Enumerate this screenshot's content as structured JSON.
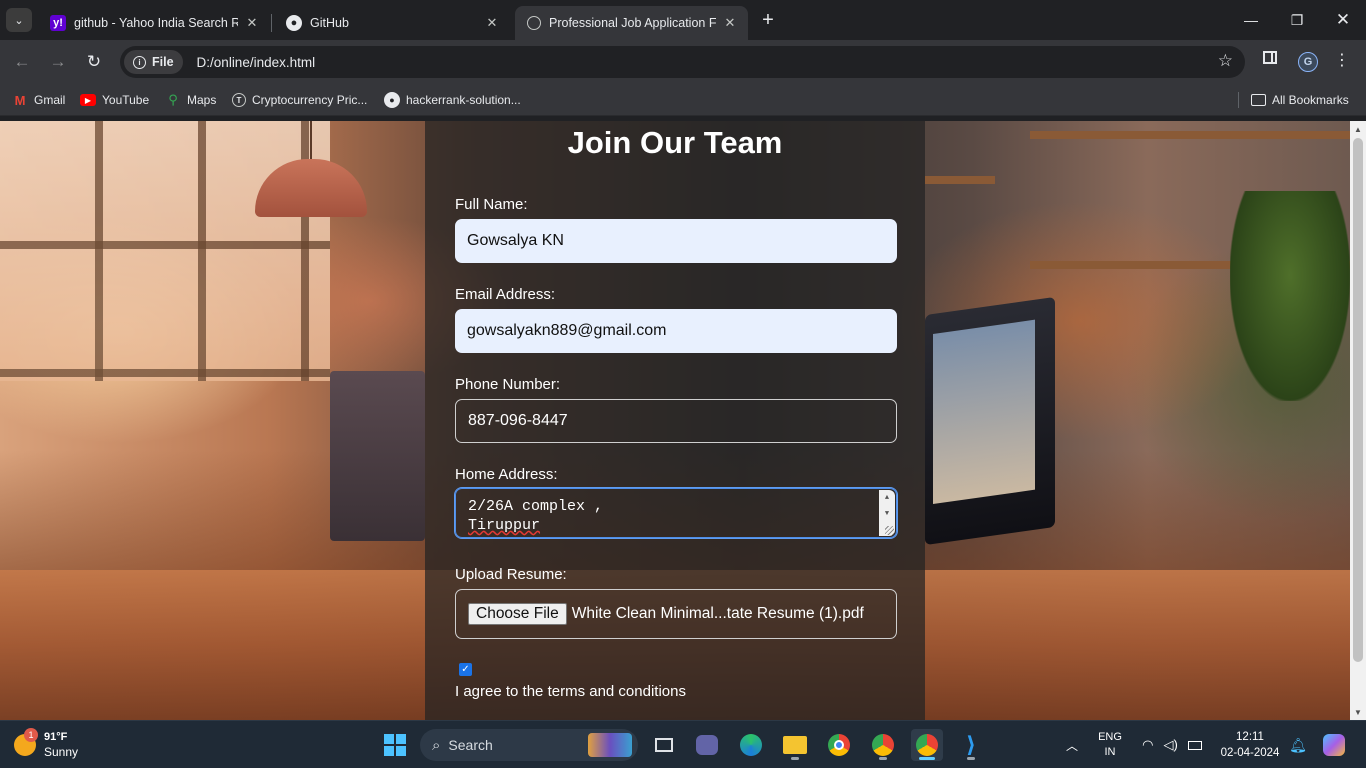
{
  "browser": {
    "tabs": [
      {
        "title": "github - Yahoo India Search Res",
        "favicon": "yahoo-icon",
        "active": false
      },
      {
        "title": "GitHub",
        "favicon": "github-icon",
        "active": false
      },
      {
        "title": "Professional Job Application For",
        "favicon": "globe-icon",
        "active": true
      }
    ],
    "new_tab": "+",
    "url_chip": "File",
    "url": "D:/online/index.html",
    "profile_initial": "G",
    "bookmarks": [
      {
        "label": "Gmail",
        "icon": "gmail-icon"
      },
      {
        "label": "YouTube",
        "icon": "youtube-icon"
      },
      {
        "label": "Maps",
        "icon": "maps-icon"
      },
      {
        "label": "Cryptocurrency Pric...",
        "icon": "crypto-icon"
      },
      {
        "label": "hackerrank-solution...",
        "icon": "github-icon"
      }
    ],
    "all_bookmarks": "All Bookmarks"
  },
  "form": {
    "heading": "Join Our Team",
    "full_name_label": "Full Name:",
    "full_name_value": "Gowsalya KN",
    "email_label": "Email Address:",
    "email_value": "gowsalyakn889@gmail.com",
    "phone_label": "Phone Number:",
    "phone_value": "887-096-8447",
    "address_label": "Home Address:",
    "address_line1": "2/26A complex ,",
    "address_line2": "Tiruppur",
    "resume_label": "Upload Resume:",
    "choose_file": "Choose File",
    "file_name": "White Clean Minimal...tate Resume (1).pdf",
    "terms_checked": true,
    "terms_label": "I agree to the terms and conditions"
  },
  "taskbar": {
    "weather_temp": "91°F",
    "weather_desc": "Sunny",
    "weather_badge": "1",
    "search_label": "Search",
    "lang_line1": "ENG",
    "lang_line2": "IN",
    "time": "12:11",
    "date": "02-04-2024"
  },
  "colors": {
    "form_bg": "#222222",
    "input_autofill_bg": "#e8f0fe",
    "checkbox_accent": "#1a73e8",
    "taskbar_bg": "#1f2a36"
  }
}
